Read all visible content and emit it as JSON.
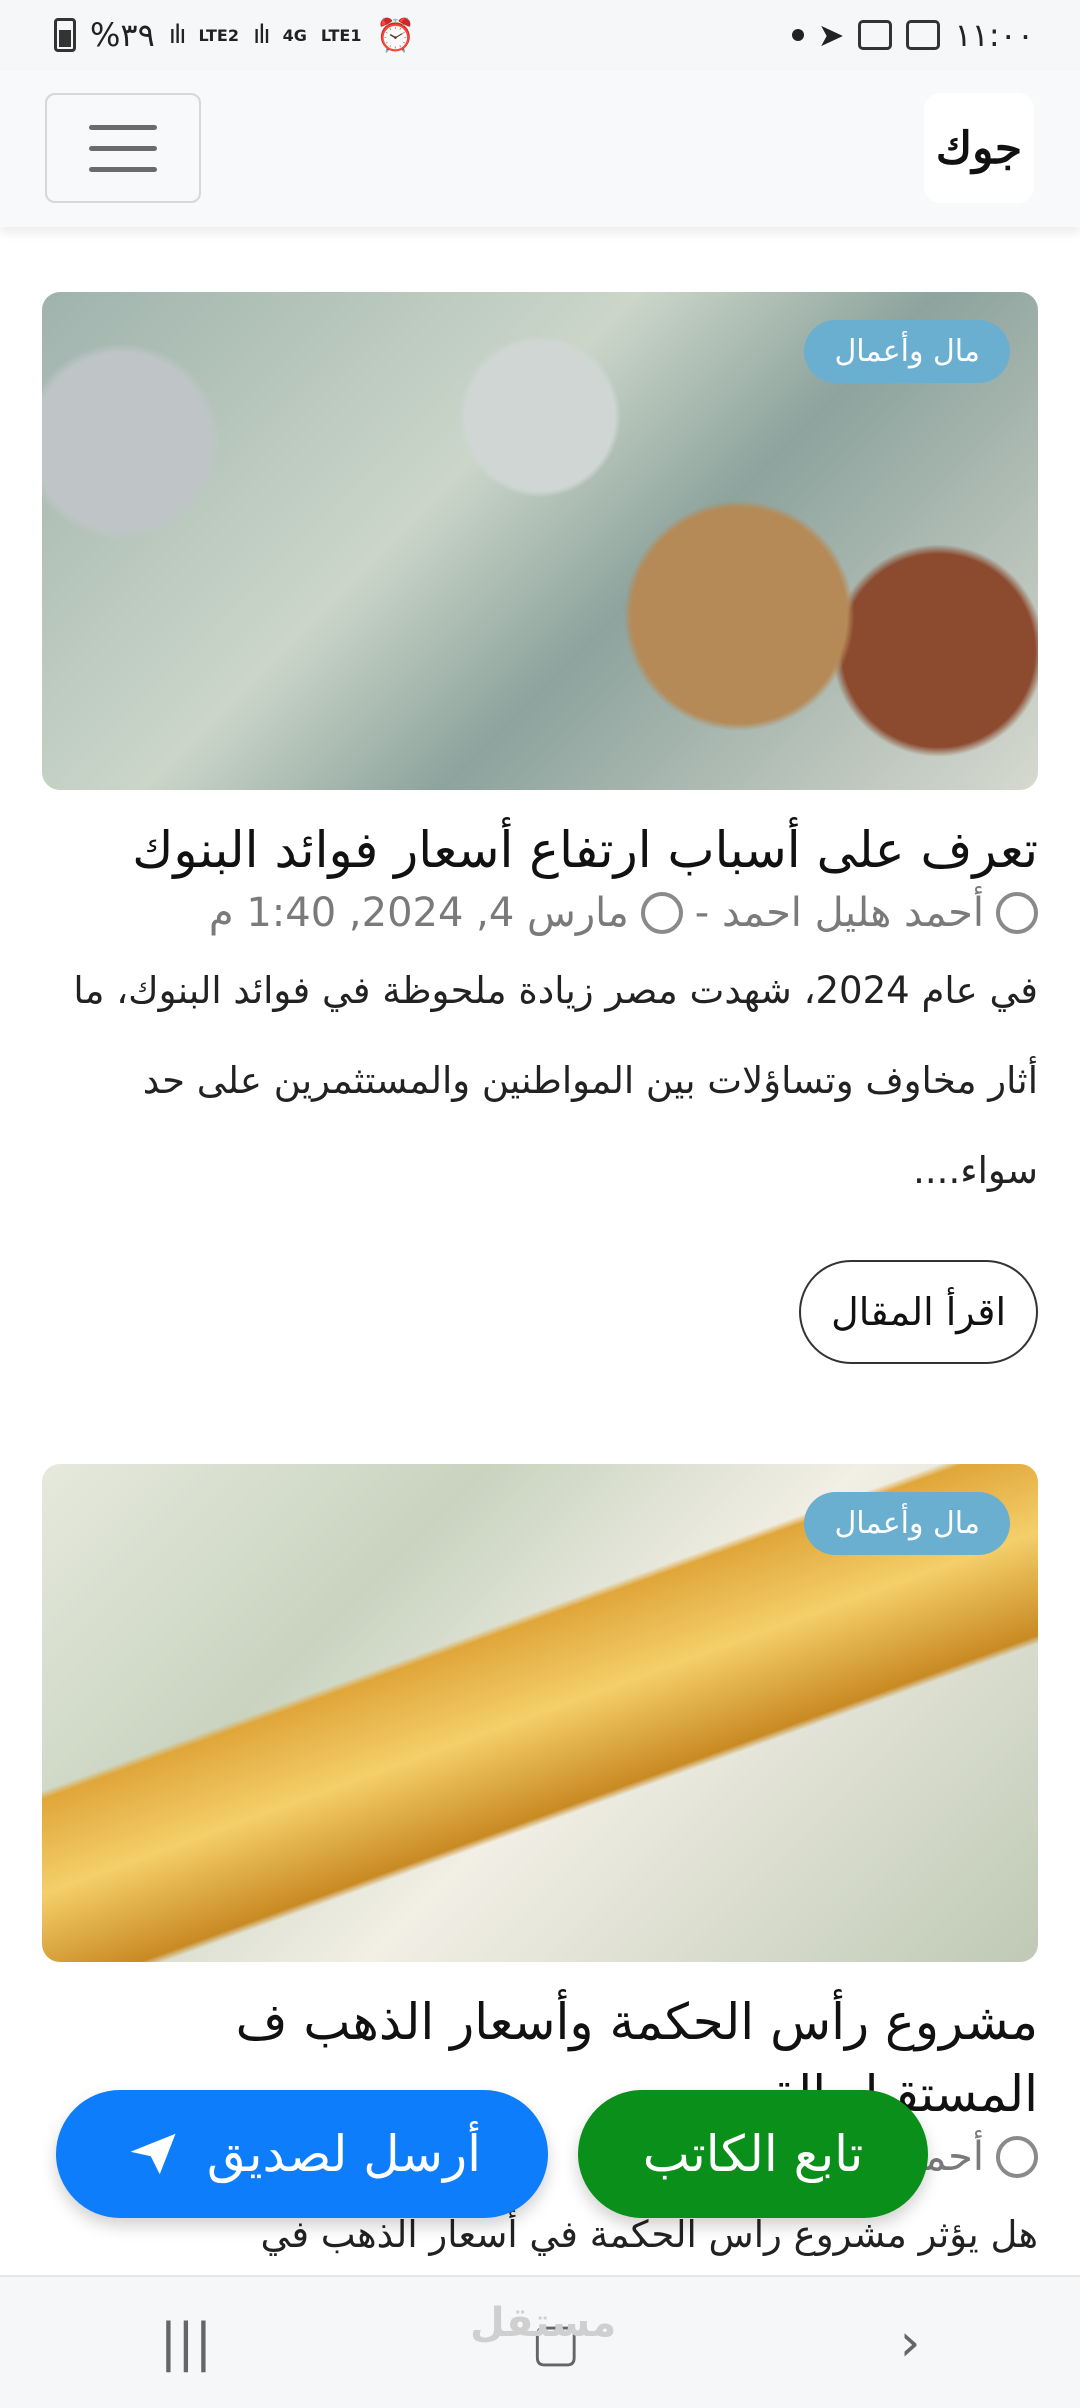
{
  "status": {
    "battery": "%٣٩",
    "sim2": "LTE2",
    "net": "4G",
    "sim1": "LTE1",
    "time": "١١:٠٠"
  },
  "header": {
    "logo_text": "جوك",
    "menu_icon": "hamburger-icon"
  },
  "articles": [
    {
      "category": "مال وأعمال",
      "title": "تعرف على أسباب ارتفاع أسعار فوائد البنوك",
      "author": "أحمد هليل احمد -",
      "date": "مارس 4, 2024, 1:40 م",
      "excerpt": "في عام 2024، شهدت مصر زيادة ملحوظة في فوائد البنوك، ما أثار مخاوف وتساؤلات بين المواطنين والمستثمرين على حد سواء....",
      "read_more": "اقرأ المقال"
    },
    {
      "category": "مال وأعمال",
      "title": "مشروع رأس الحكمة وأسعار الذهب ف المستقبل القريب",
      "author": "أحمد",
      "excerpt": "هل يؤثر مشروع رأس الحكمة في أسعار الذهب في"
    }
  ],
  "fab": {
    "share": "أرسل لصديق",
    "follow": "تابع الكاتب"
  },
  "bottom_nav": {
    "recents": "|||",
    "home": "▢",
    "back": "›",
    "watermark": "مستقل"
  },
  "colors": {
    "badge": "#6aafd0",
    "share_button": "#0d7dfb",
    "follow_button": "#0a8f1b"
  }
}
